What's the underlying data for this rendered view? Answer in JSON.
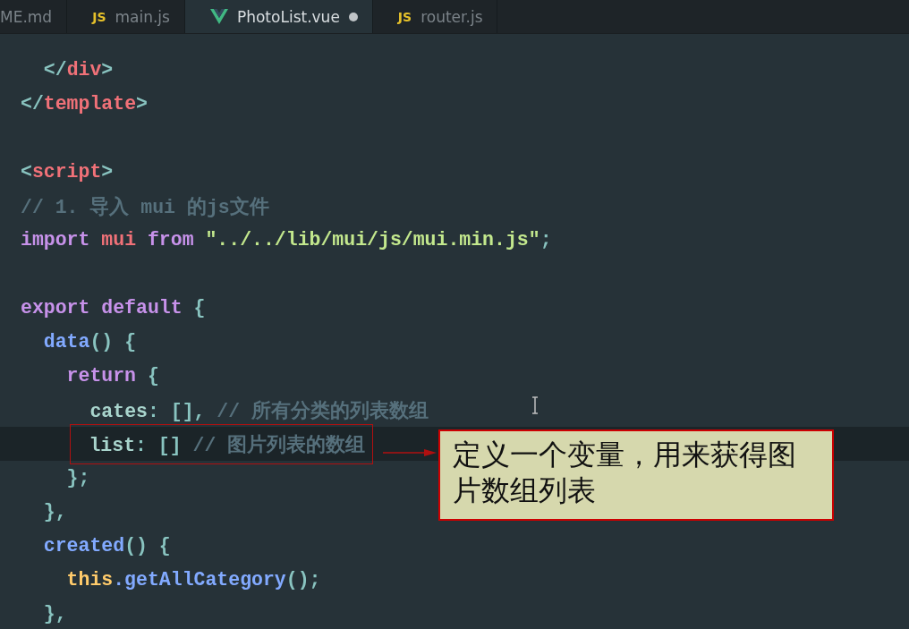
{
  "tabs": [
    {
      "label": "ME.md",
      "kind": "plain",
      "selected": false,
      "modified": false
    },
    {
      "label": "main.js",
      "kind": "js",
      "icon_text": "JS",
      "selected": false,
      "modified": false
    },
    {
      "label": "PhotoList.vue",
      "kind": "vue",
      "selected": true,
      "modified": true
    },
    {
      "label": "router.js",
      "kind": "js",
      "icon_text": "JS",
      "selected": false,
      "modified": false
    }
  ],
  "code_lines": [
    {
      "highlighted": false,
      "framed": false,
      "tokens": [
        {
          "text": "  </",
          "kind": "punct"
        },
        {
          "text": "div",
          "kind": "tag"
        },
        {
          "text": ">",
          "kind": "punct"
        }
      ]
    },
    {
      "highlighted": false,
      "framed": false,
      "tokens": [
        {
          "text": "</",
          "kind": "punct"
        },
        {
          "text": "template",
          "kind": "tag"
        },
        {
          "text": ">",
          "kind": "punct"
        }
      ]
    },
    {
      "highlighted": false
    },
    {
      "highlighted": false,
      "framed": false,
      "tokens": [
        {
          "text": "<",
          "kind": "punct"
        },
        {
          "text": "script",
          "kind": "tag"
        },
        {
          "text": ">",
          "kind": "punct"
        }
      ]
    },
    {
      "highlighted": false,
      "framed": false,
      "tokens": [
        {
          "text": "// 1. 导入 mui 的js文件",
          "kind": "comment"
        }
      ]
    },
    {
      "highlighted": false,
      "framed": false,
      "tokens": [
        {
          "text": "import",
          "kind": "keyword"
        },
        {
          "text": " mui",
          "kind": "variable"
        },
        {
          "text": " from",
          "kind": "keyword"
        },
        {
          "text": " \"../../lib/mui/js/mui.min.js\"",
          "kind": "string"
        },
        {
          "text": ";",
          "kind": "punct"
        }
      ]
    },
    {
      "highlighted": false
    },
    {
      "highlighted": false,
      "framed": false,
      "tokens": [
        {
          "text": "export default",
          "kind": "keyword"
        },
        {
          "text": " {",
          "kind": "punct"
        }
      ]
    },
    {
      "highlighted": false,
      "framed": false,
      "tokens": [
        {
          "text": "  data",
          "kind": "function"
        },
        {
          "text": "() {",
          "kind": "punct"
        }
      ]
    },
    {
      "highlighted": false,
      "framed": false,
      "tokens": [
        {
          "text": "    return",
          "kind": "keyword"
        },
        {
          "text": " {",
          "kind": "punct"
        }
      ]
    },
    {
      "highlighted": false,
      "framed": false,
      "tokens": [
        {
          "text": "      cates",
          "kind": "property"
        },
        {
          "text": ": [],",
          "kind": "punct"
        },
        {
          "text": " // 所有分类的列表数组",
          "kind": "comment"
        }
      ]
    },
    {
      "highlighted": true,
      "framed": true,
      "tokens": [
        {
          "text": "      list",
          "kind": "property"
        },
        {
          "text": ": []",
          "kind": "punct"
        },
        {
          "text": " // 图片列表的数组",
          "kind": "comment"
        }
      ]
    },
    {
      "highlighted": false,
      "framed": false,
      "tokens": [
        {
          "text": "    };",
          "kind": "punct"
        }
      ]
    },
    {
      "highlighted": false,
      "framed": false,
      "tokens": [
        {
          "text": "  },",
          "kind": "punct"
        }
      ]
    },
    {
      "highlighted": false,
      "framed": false,
      "tokens": [
        {
          "text": "  created",
          "kind": "function"
        },
        {
          "text": "() {",
          "kind": "punct"
        }
      ]
    },
    {
      "highlighted": false,
      "framed": false,
      "tokens": [
        {
          "text": "    this",
          "kind": "this"
        },
        {
          "text": ".getAllCategory",
          "kind": "function"
        },
        {
          "text": "();",
          "kind": "punct"
        }
      ]
    },
    {
      "highlighted": false,
      "framed": false,
      "tokens": [
        {
          "text": "  },",
          "kind": "punct"
        }
      ]
    }
  ],
  "callout": {
    "text": "定义一个变量，用来获得图片数组列表"
  }
}
